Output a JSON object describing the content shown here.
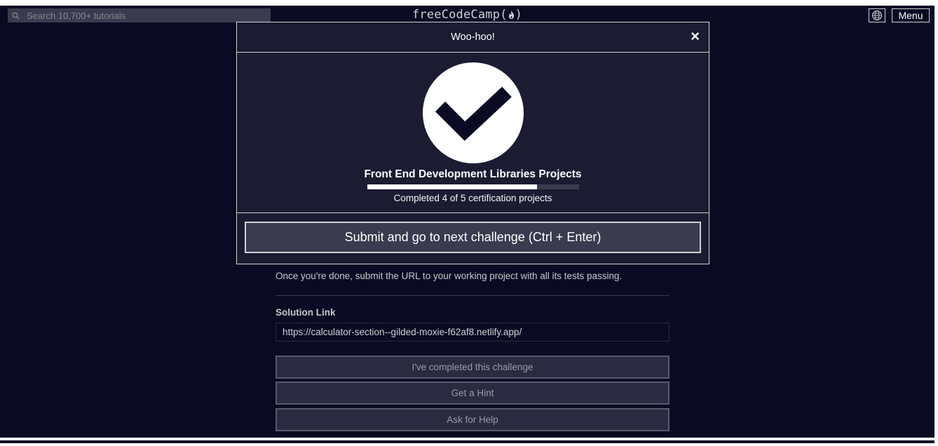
{
  "navbar": {
    "search_placeholder": "Search 10,700+ tutorials",
    "logo_text": "freeCodeCamp(",
    "logo_text_end": ")",
    "menu_label": "Menu"
  },
  "modal": {
    "title": "Woo-hoo!",
    "close_label": "×",
    "certification_title": "Front End Development Libraries Projects",
    "progress": {
      "completed": 4,
      "total": 5
    },
    "progress_text": "Completed 4 of 5 certification projects",
    "submit_label": "Submit and go to next challenge (Ctrl + Enter)"
  },
  "challenge": {
    "instructions": "Once you're done, submit the URL to your working project with all its tests passing.",
    "solution_label": "Solution Link",
    "solution_value": "https://calculator-section--gilded-moxie-f62af8.netlify.app/",
    "completed_button": "I've completed this challenge",
    "hint_button": "Get a Hint",
    "help_button": "Ask for Help"
  },
  "colors": {
    "background": "#0a0a23",
    "modal_bg": "#1b1b32",
    "accent_white": "#ffffff"
  }
}
